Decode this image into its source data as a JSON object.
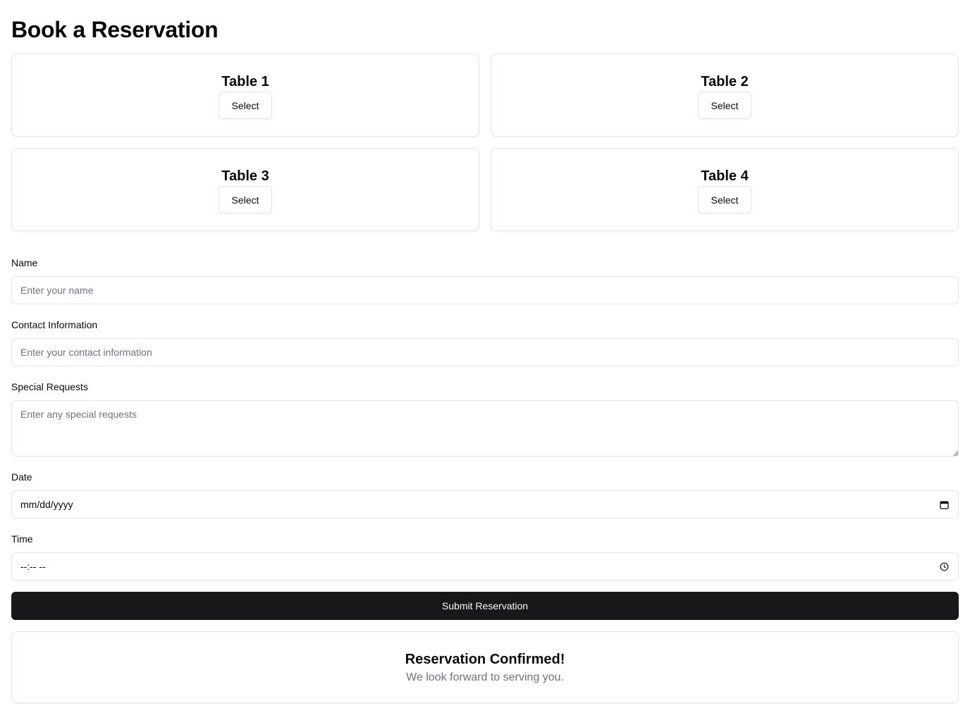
{
  "page": {
    "title": "Book a Reservation"
  },
  "tables": [
    {
      "name": "Table 1",
      "button": "Select"
    },
    {
      "name": "Table 2",
      "button": "Select"
    },
    {
      "name": "Table 3",
      "button": "Select"
    },
    {
      "name": "Table 4",
      "button": "Select"
    }
  ],
  "form": {
    "name": {
      "label": "Name",
      "placeholder": "Enter your name",
      "value": ""
    },
    "contact": {
      "label": "Contact Information",
      "placeholder": "Enter your contact information",
      "value": ""
    },
    "requests": {
      "label": "Special Requests",
      "placeholder": "Enter any special requests",
      "value": ""
    },
    "date": {
      "label": "Date",
      "display": "mm/dd/yyyy",
      "icon": "calendar-icon"
    },
    "time": {
      "label": "Time",
      "display": "--:-- --",
      "icon": "clock-icon"
    },
    "submit_label": "Submit Reservation"
  },
  "confirmation": {
    "title": "Reservation Confirmed!",
    "message": "We look forward to serving you."
  }
}
